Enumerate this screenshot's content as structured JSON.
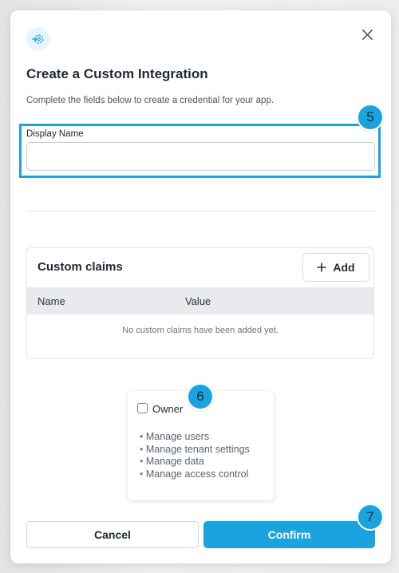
{
  "dialog": {
    "title": "Create a Custom Integration",
    "subtitle": "Complete the fields below to create a credential for your app.",
    "icon": "integration-gear-icon",
    "close_icon": "close-icon"
  },
  "display_name": {
    "label": "Display Name",
    "value": "",
    "placeholder": ""
  },
  "custom_claims": {
    "title": "Custom claims",
    "add_label": "Add",
    "columns": [
      "Name",
      "Value"
    ],
    "empty_text": "No custom claims have been added yet."
  },
  "role": {
    "label": "Owner",
    "checked": false,
    "permissions": [
      "Manage users",
      "Manage tenant settings",
      "Manage data",
      "Manage access control"
    ]
  },
  "actions": {
    "cancel_label": "Cancel",
    "confirm_label": "Confirm"
  },
  "step_badges": [
    "5",
    "6",
    "7"
  ],
  "colors": {
    "accent": "#1ba3e0",
    "text": "#1f2933",
    "muted": "#4a5563",
    "header_bg": "#e9eaed"
  }
}
